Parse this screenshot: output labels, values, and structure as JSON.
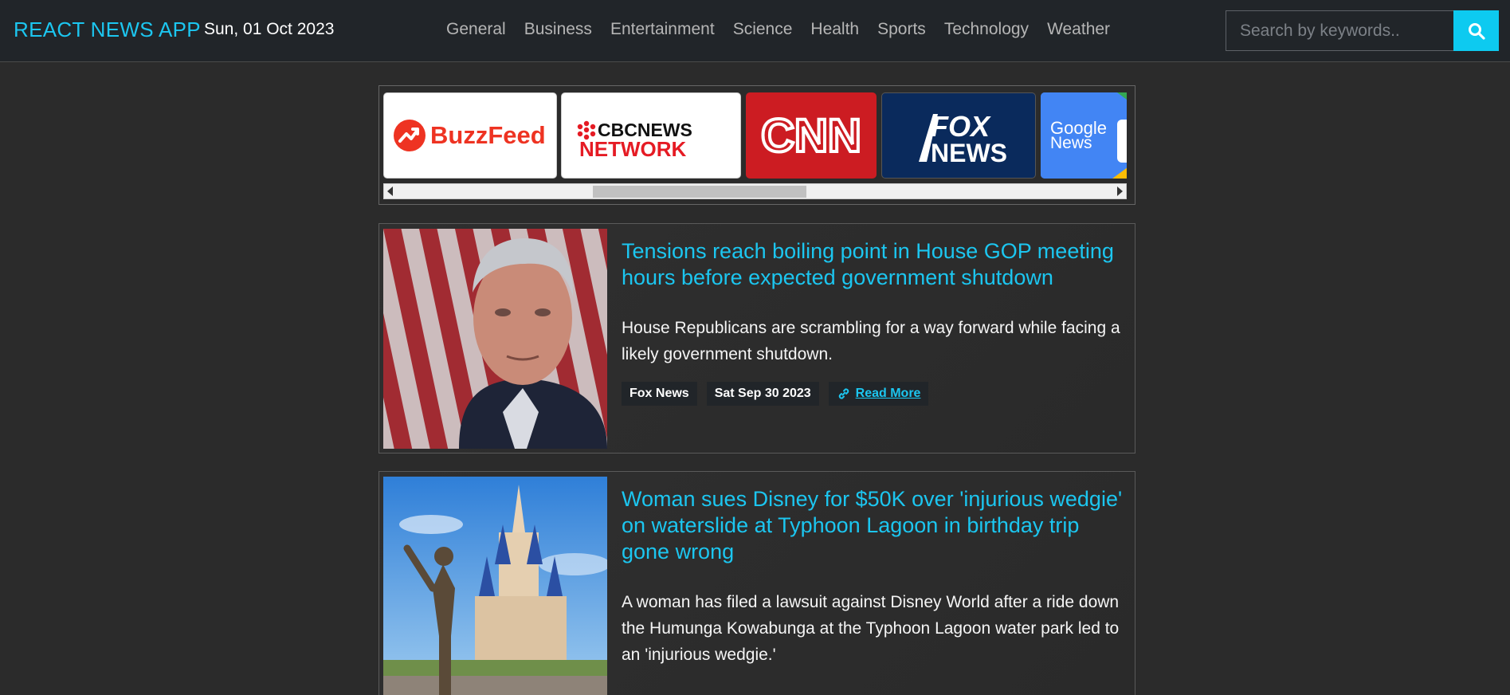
{
  "brand": "REACT NEWS APP",
  "date": "Sun, 01 Oct 2023",
  "nav": [
    "General",
    "Business",
    "Entertainment",
    "Science",
    "Health",
    "Sports",
    "Technology",
    "Weather"
  ],
  "search": {
    "placeholder": "Search by keywords..",
    "button_icon": "search-icon"
  },
  "sources": {
    "buzzfeed": "BuzzFeed",
    "cbc_top": "CBCNEWS",
    "cbc_bottom": "NETWORK",
    "cnn": "CNN",
    "fox_top": "FOX",
    "fox_bottom": "NEWS",
    "google_top": "Google",
    "google_bottom": "News"
  },
  "articles": [
    {
      "title": "Tensions reach boiling point in House GOP meeting hours before expected government shutdown",
      "description": "House Republicans are scrambling for a way forward while facing a likely government shutdown.",
      "source": "Fox News",
      "date": "Sat Sep 30 2023",
      "read_more": "Read More"
    },
    {
      "title": "Woman sues Disney for $50K over 'injurious wedgie' on waterslide at Typhoon Lagoon in birthday trip gone wrong",
      "description": "A woman has filed a lawsuit against Disney World after a ride down the Humunga Kowabunga at the Typhoon Lagoon water park led to an 'injurious wedgie.'"
    }
  ],
  "colors": {
    "accent": "#1cc6f0",
    "navbar": "#212529",
    "background": "#2b2b2b",
    "search_button": "#0dcaf0"
  }
}
